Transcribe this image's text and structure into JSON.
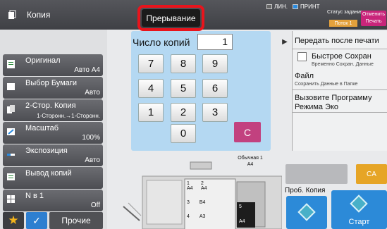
{
  "topbar": {
    "mode_label": "Копия",
    "interrupt_label": "Прерывание",
    "status_line": "ЛИН.",
    "status_print": "ПРИНТ",
    "job_status_label": "Статус задания",
    "job_bar_label": "Поток 1",
    "cancel_print_label": "Отменить Печать"
  },
  "left": {
    "original": {
      "label": "Оригинал",
      "value": "Авто A4"
    },
    "paper": {
      "label": "Выбор Бумаги",
      "value": "Авто"
    },
    "duplex": {
      "label": "2-Стор. Копия",
      "value": "1-Сторонн.→1-Сторонн."
    },
    "scale": {
      "label": "Масштаб",
      "value": "100%"
    },
    "exposure": {
      "label": "Экспозиция",
      "value": "Авто"
    },
    "output": {
      "label": "Вывод копий"
    },
    "nup": {
      "label": "N в 1",
      "value": "Off"
    },
    "other_label": "Прочие"
  },
  "keypad": {
    "copies_label": "Число копий",
    "copies_value": "1",
    "keys": [
      "7",
      "8",
      "9",
      "4",
      "5",
      "6",
      "1",
      "2",
      "3",
      "0"
    ],
    "clear_label": "C"
  },
  "right": {
    "send_after_print": "Передать после печати",
    "quick_save_title": "Быстрое Сохран",
    "quick_save_sub": "Временно Сохран. Данные",
    "file_title": "Файл",
    "file_sub": "Сохранить Данные в Папке",
    "eco_title": "Вызовите Программу Режима Эко"
  },
  "machine": {
    "paper_info": "Обычная 1",
    "paper_size": "A4",
    "trays": [
      {
        "num": "1",
        "size": "A4"
      },
      {
        "num": "2",
        "size": "A4"
      },
      {
        "num": "3",
        "size": "B4"
      },
      {
        "num": "4",
        "size": "A3"
      }
    ],
    "bypass_num": "5",
    "bypass_size": "A4"
  },
  "actions": {
    "ca_label": "CA",
    "proof_label": "Проб. Копия",
    "start_label": "Старт"
  }
}
